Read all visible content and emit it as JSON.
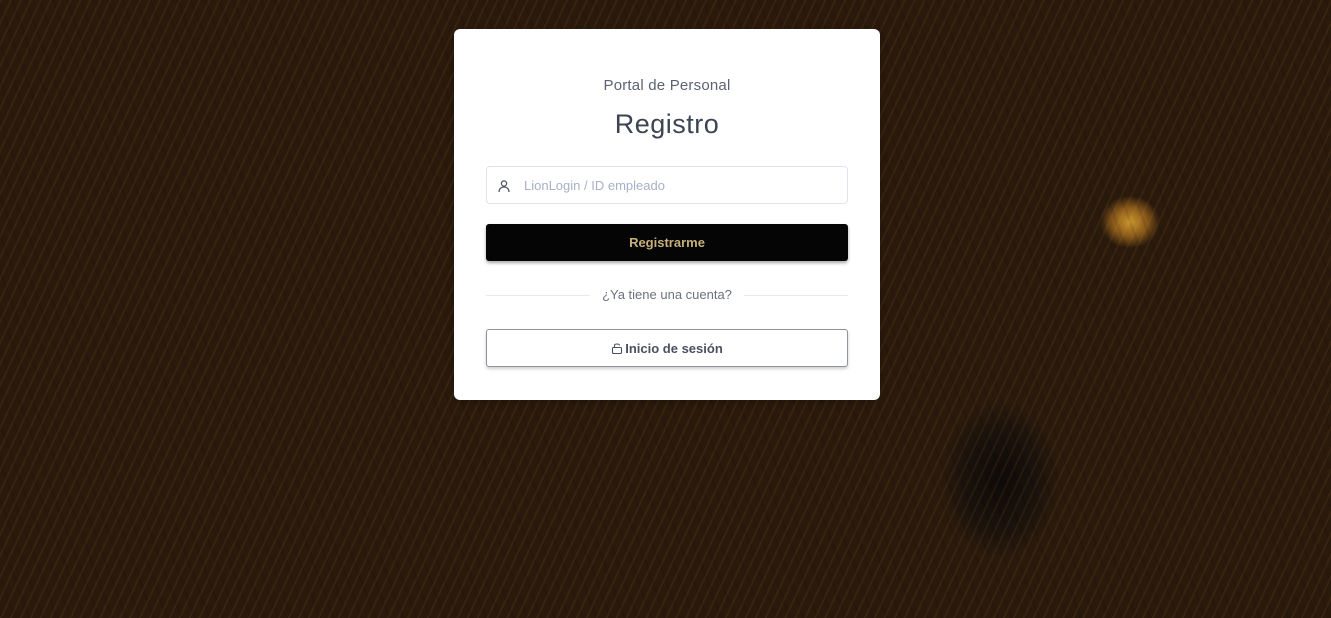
{
  "card": {
    "subtitle": "Portal de Personal",
    "title": "Registro"
  },
  "login_field": {
    "icon": "user-icon",
    "placeholder": "LionLogin / ID empleado",
    "value": ""
  },
  "register_button": {
    "label": "Registrarme"
  },
  "divider": {
    "text": "¿Ya tiene una cuenta?"
  },
  "login_button": {
    "icon": "lock-icon",
    "label": "Inicio de sesión"
  },
  "colors": {
    "register_button_bg": "#050505",
    "register_button_text": "#c8b07a",
    "card_bg": "#ffffff"
  }
}
